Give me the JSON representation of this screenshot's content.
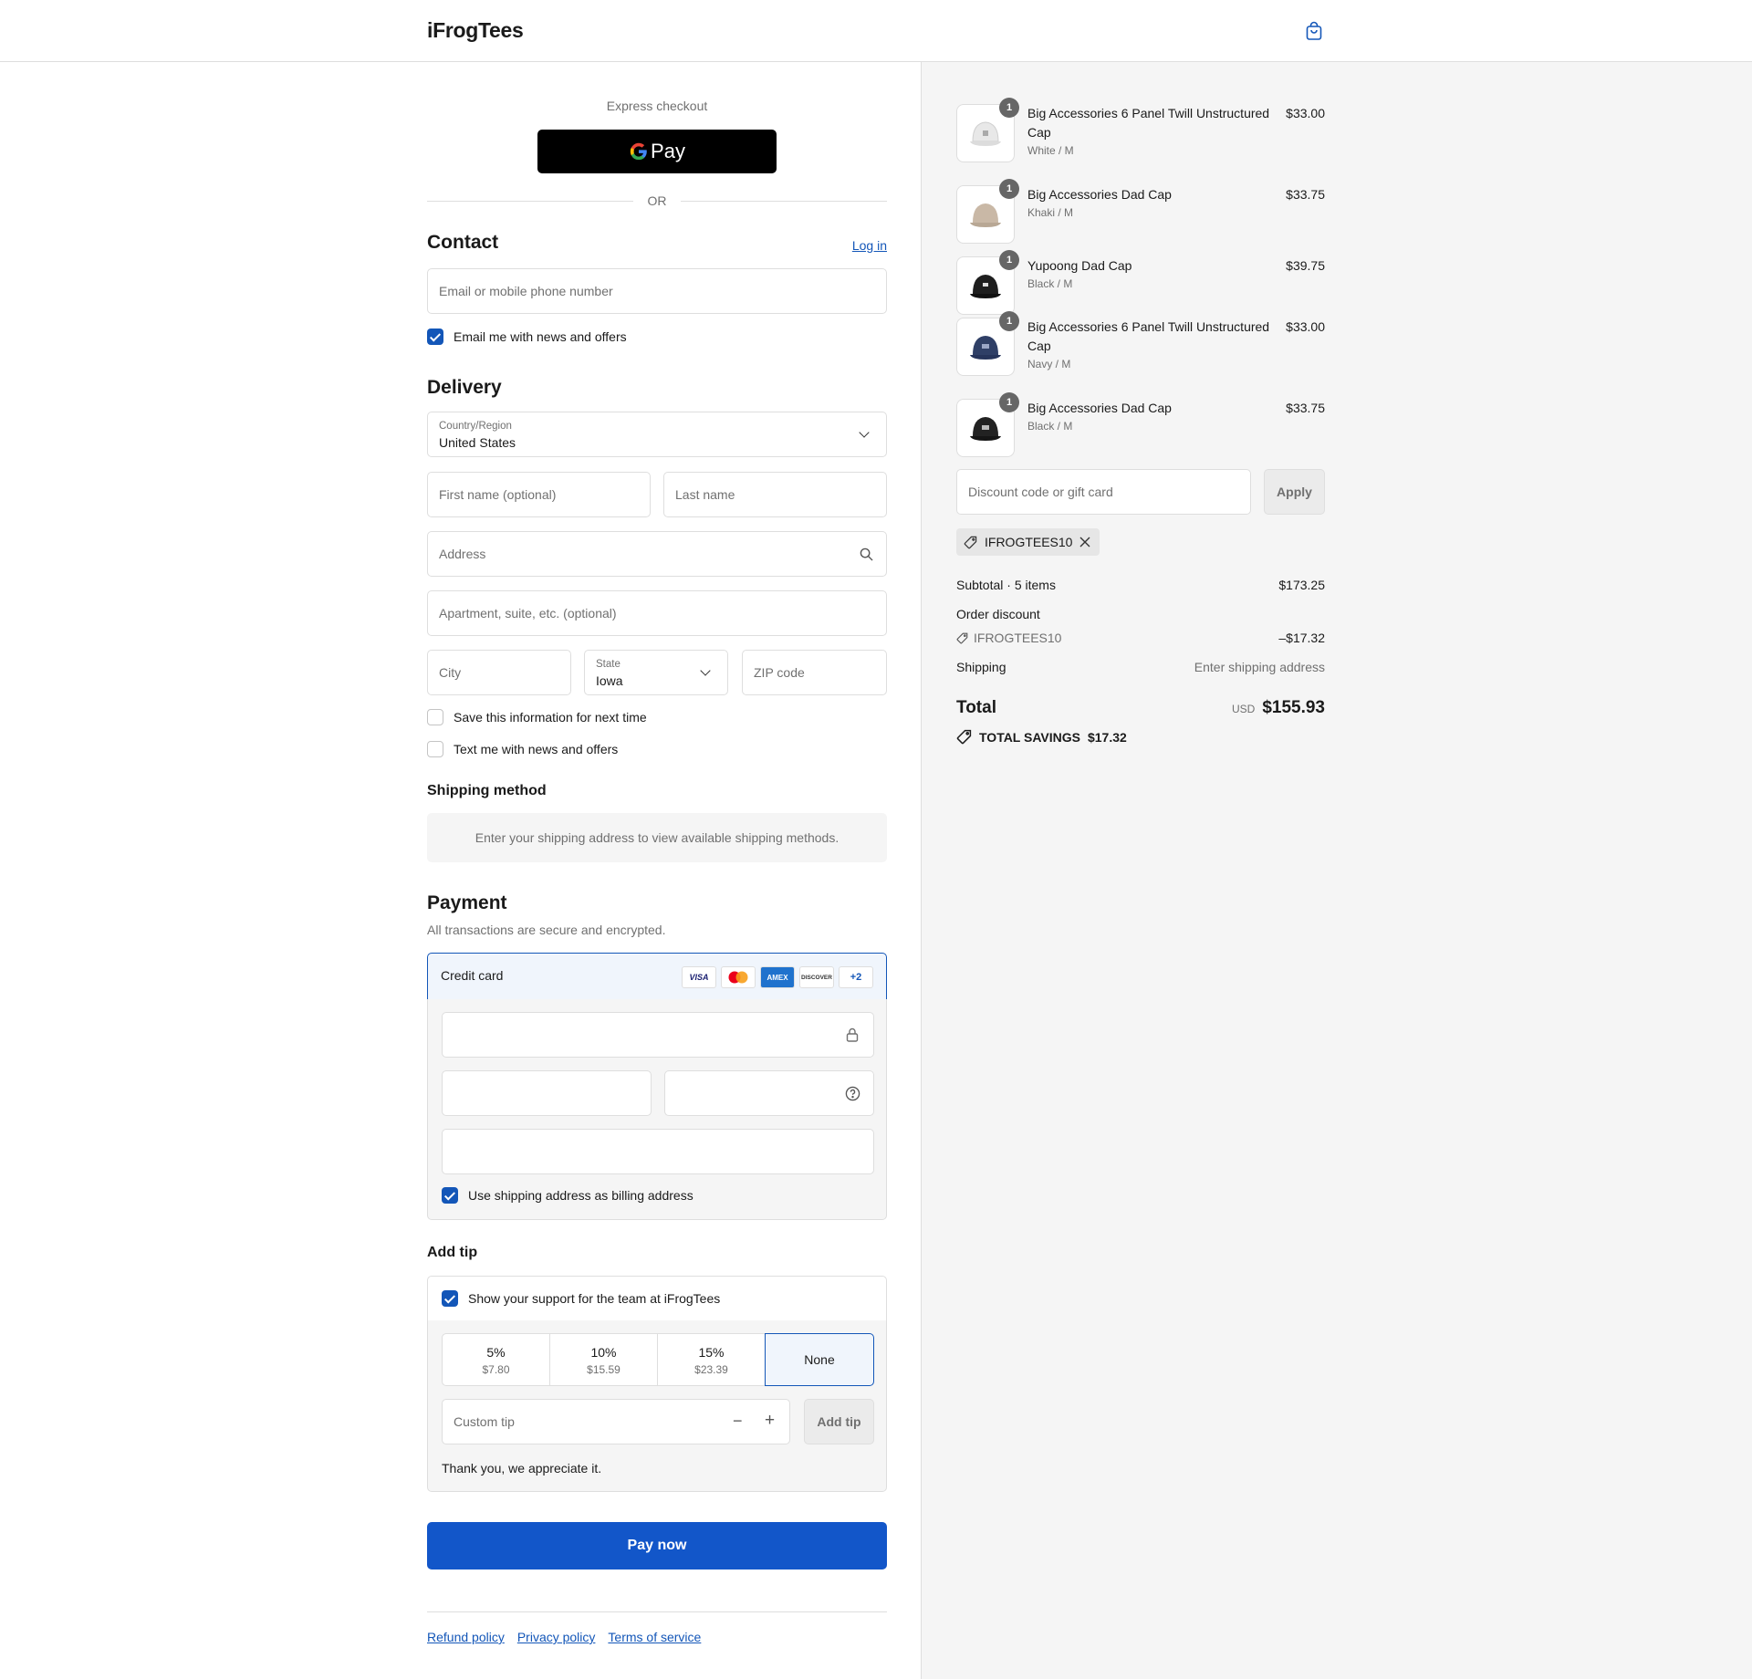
{
  "header": {
    "brand": "iFrogTees",
    "bag_icon": "shopping-bag-icon"
  },
  "express": {
    "label": "Express checkout",
    "gpay_label": "Pay",
    "or_label": "OR"
  },
  "contact": {
    "title": "Contact",
    "login_link": "Log in",
    "email_placeholder": "Email or mobile phone number",
    "news_checkbox_label": "Email me with news and offers",
    "news_checked": true
  },
  "delivery": {
    "title": "Delivery",
    "country_label": "Country/Region",
    "country_value": "United States",
    "first_name_placeholder": "First name (optional)",
    "last_name_placeholder": "Last name",
    "address_placeholder": "Address",
    "apartment_placeholder": "Apartment, suite, etc. (optional)",
    "city_placeholder": "City",
    "state_label": "State",
    "state_value": "Iowa",
    "zip_placeholder": "ZIP code",
    "save_info_label": "Save this information for next time",
    "text_me_label": "Text me with news and offers"
  },
  "shipping_method": {
    "title": "Shipping method",
    "message": "Enter your shipping address to view available shipping methods."
  },
  "payment": {
    "title": "Payment",
    "subtitle": "All transactions are secure and encrypted.",
    "method_label": "Credit card",
    "card_logos": [
      "VISA",
      "Mastercard",
      "AMEX",
      "DISCOVER",
      "+2"
    ],
    "billing_label": "Use shipping address as billing address",
    "billing_checked": true
  },
  "tip": {
    "title": "Add tip",
    "support_label": "Show your support for the team at iFrogTees",
    "support_checked": true,
    "options": [
      {
        "pct": "5%",
        "amount": "$7.80"
      },
      {
        "pct": "10%",
        "amount": "$15.59"
      },
      {
        "pct": "15%",
        "amount": "$23.39"
      },
      {
        "pct": "None",
        "amount": ""
      }
    ],
    "selected": "None",
    "custom_placeholder": "Custom tip",
    "add_button": "Add tip",
    "thanks": "Thank you, we appreciate it."
  },
  "pay_button": "Pay now",
  "footer": {
    "links": [
      "Refund policy",
      "Privacy policy",
      "Terms of service"
    ]
  },
  "order": {
    "items": [
      {
        "name": "Big Accessories 6 Panel Twill Unstructured Cap",
        "variant": "White / M",
        "price": "$33.00",
        "qty": "1",
        "color": "#e8e8e8"
      },
      {
        "name": "Big Accessories Dad Cap",
        "variant": "Khaki / M",
        "price": "$33.75",
        "qty": "1",
        "color": "#c9b8a6"
      },
      {
        "name": "Yupoong Dad Cap",
        "variant": "Black / M",
        "price": "$39.75",
        "qty": "1",
        "color": "#1e1e1e"
      },
      {
        "name": "Big Accessories 6 Panel Twill Unstructured Cap",
        "variant": "Navy / M",
        "price": "$33.00",
        "qty": "1",
        "color": "#2f3f66"
      },
      {
        "name": "Big Accessories Dad Cap",
        "variant": "Black / M",
        "price": "$33.75",
        "qty": "1",
        "color": "#222222"
      }
    ],
    "discount_placeholder": "Discount code or gift card",
    "apply_button": "Apply",
    "applied_code": "IFROGTEES10",
    "subtotal_label": "Subtotal · 5 items",
    "subtotal_value": "$173.25",
    "order_discount_label": "Order discount",
    "discount_code": "IFROGTEES10",
    "discount_value": "–$17.32",
    "shipping_label": "Shipping",
    "shipping_value": "Enter shipping address",
    "total_label": "Total",
    "currency": "USD",
    "total_value": "$155.93",
    "savings_label": "TOTAL SAVINGS",
    "savings_value": "$17.32"
  },
  "colors": {
    "accent": "#1356b8",
    "pay_button": "#1256c9"
  }
}
